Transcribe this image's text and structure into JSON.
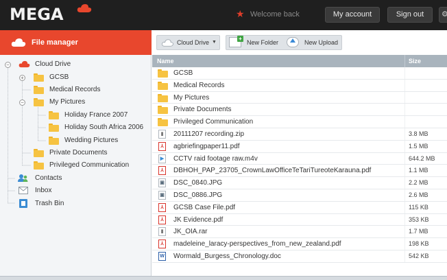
{
  "header": {
    "logo_text": "MEGA",
    "welcome_text": "Welcome back",
    "my_account_label": "My account",
    "sign_out_label": "Sign out",
    "accent_color": "#e8472d"
  },
  "sidebar": {
    "title": "File manager",
    "tree": [
      {
        "label": "Cloud Drive",
        "icon": "cloud-icon"
      },
      {
        "label": "GCSB",
        "icon": "folder-icon"
      },
      {
        "label": "Medical Records",
        "icon": "folder-icon"
      },
      {
        "label": "My Pictures",
        "icon": "folder-open-icon"
      },
      {
        "label": "Holiday France 2007",
        "icon": "folder-icon"
      },
      {
        "label": "Holiday South Africa 2006",
        "icon": "folder-icon"
      },
      {
        "label": "Wedding Pictures",
        "icon": "folder-icon"
      },
      {
        "label": "Private Documents",
        "icon": "folder-icon"
      },
      {
        "label": "Privileged Communication",
        "icon": "folder-icon"
      },
      {
        "label": "Contacts",
        "icon": "contacts-icon"
      },
      {
        "label": "Inbox",
        "icon": "inbox-icon"
      },
      {
        "label": "Trash Bin",
        "icon": "trash-icon"
      }
    ]
  },
  "toolbar": {
    "cloud_drive_label": "Cloud Drive",
    "new_folder_label": "New Folder",
    "new_upload_label": "New Upload"
  },
  "file_list": {
    "columns": {
      "name": "Name",
      "size": "Size"
    },
    "rows": [
      {
        "name": "GCSB",
        "size": "",
        "type": "folder"
      },
      {
        "name": "Medical Records",
        "size": "",
        "type": "folder"
      },
      {
        "name": "My Pictures",
        "size": "",
        "type": "folder"
      },
      {
        "name": "Private Documents",
        "size": "",
        "type": "folder"
      },
      {
        "name": "Privileged Communication",
        "size": "",
        "type": "folder"
      },
      {
        "name": "20111207 recording.zip",
        "size": "3.8 MB",
        "type": "zip"
      },
      {
        "name": "agbriefingpaper11.pdf",
        "size": "1.5 MB",
        "type": "pdf"
      },
      {
        "name": "CCTV raid footage raw.m4v",
        "size": "644.2 MB",
        "type": "video"
      },
      {
        "name": "DBHOH_PAP_23705_CrownLawOfficeTeTariTureoteKarauna.pdf",
        "size": "1.1 MB",
        "type": "pdf"
      },
      {
        "name": "DSC_0840.JPG",
        "size": "2.2 MB",
        "type": "image"
      },
      {
        "name": "DSC_0886.JPG",
        "size": "2.6 MB",
        "type": "image"
      },
      {
        "name": "GCSB Case File.pdf",
        "size": "115 KB",
        "type": "pdf"
      },
      {
        "name": "JK Evidence.pdf",
        "size": "353 KB",
        "type": "pdf"
      },
      {
        "name": "JK_OIA.rar",
        "size": "1.7 MB",
        "type": "zip"
      },
      {
        "name": "madeleine_laracy-perspectives_from_new_zealand.pdf",
        "size": "198 KB",
        "type": "pdf"
      },
      {
        "name": "Wormald_Burgess_Chronology.doc",
        "size": "542 KB",
        "type": "word"
      }
    ]
  }
}
